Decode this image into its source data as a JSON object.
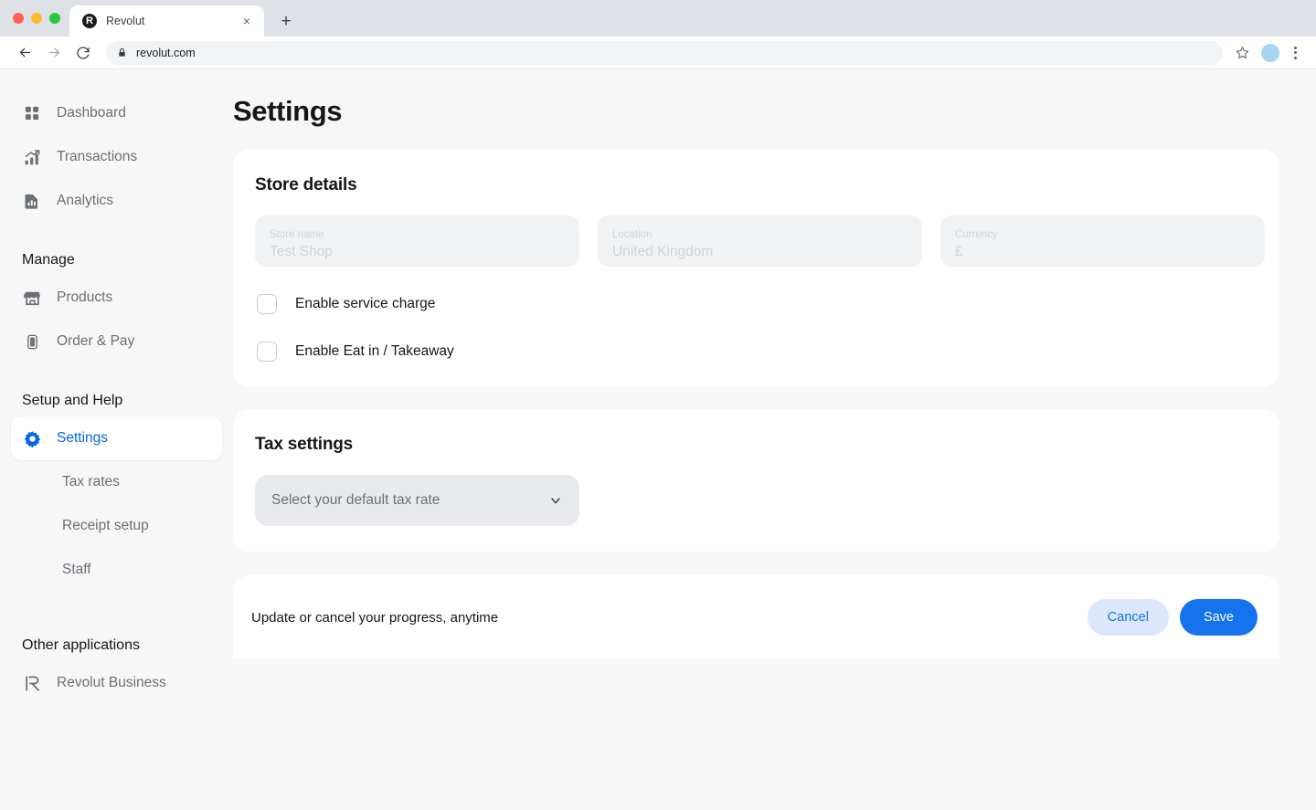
{
  "browser": {
    "tab": {
      "title": "Revolut",
      "favicon_letter": "R",
      "close_label": "×"
    },
    "new_tab_label": "+",
    "url": "revolut.com"
  },
  "sidebar": {
    "items": [
      {
        "label": "Dashboard",
        "icon": "grid-icon"
      },
      {
        "label": "Transactions",
        "icon": "bar-chart-arrow-icon"
      },
      {
        "label": "Analytics",
        "icon": "document-chart-icon"
      }
    ],
    "groups": [
      {
        "title": "Manage",
        "items": [
          {
            "label": "Products",
            "icon": "store-icon"
          },
          {
            "label": "Order & Pay",
            "icon": "mobile-icon"
          }
        ]
      },
      {
        "title": "Setup and Help",
        "items": [
          {
            "label": "Settings",
            "icon": "gear-icon",
            "active": true
          },
          {
            "label": "Tax rates",
            "icon": "",
            "sub": true
          },
          {
            "label": "Receipt setup",
            "icon": "",
            "sub": true
          },
          {
            "label": "Staff",
            "icon": "",
            "sub": true
          }
        ]
      },
      {
        "title": "Other applications",
        "items": [
          {
            "label": "Revolut Business",
            "icon": "revolut-r-icon"
          }
        ]
      }
    ]
  },
  "page": {
    "title": "Settings"
  },
  "store_details": {
    "title": "Store details",
    "fields": [
      {
        "label": "Store name",
        "value": "Test Shop"
      },
      {
        "label": "Location",
        "value": "United Kingdom"
      },
      {
        "label": "Currency",
        "value": "£"
      }
    ],
    "checkboxes": [
      {
        "label": "Enable service charge",
        "checked": false
      },
      {
        "label": "Enable Eat in / Takeaway",
        "checked": false
      }
    ]
  },
  "tax_settings": {
    "title": "Tax settings",
    "select": {
      "value": "Select your default tax rate"
    }
  },
  "footer": {
    "text": "Update or cancel your progress, anytime",
    "cancel_label": "Cancel",
    "save_label": "Save"
  },
  "colors": {
    "accent": "#1573ee",
    "accent_soft": "#dbe8fb",
    "page_bg": "#f7f7f7",
    "card_bg": "#ffffff",
    "field_bg": "#f1f2f4",
    "select_bg": "#e9eaee"
  }
}
